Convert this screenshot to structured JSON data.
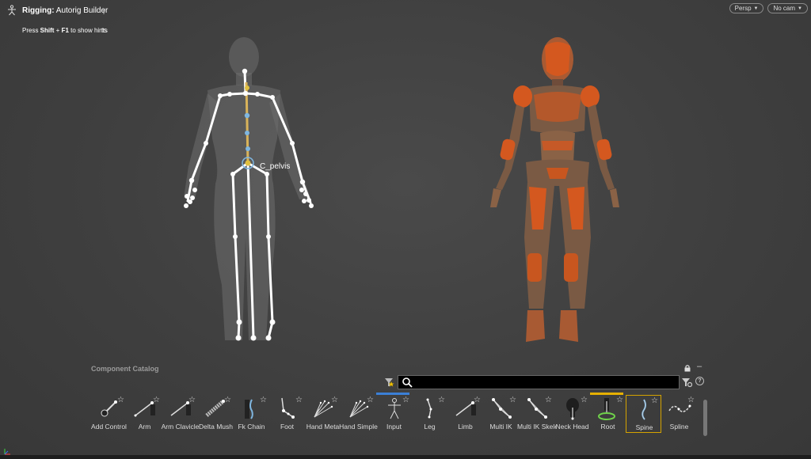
{
  "hud": {
    "title_bold": "Rigging:",
    "title_rest": " Autorig Builder",
    "hint_prefix": "Press ",
    "hint_key1": "Shift",
    "hint_plus": " + ",
    "hint_key2": "F1",
    "hint_suffix": " to show hints",
    "ghost_text_1": "r",
    "ghost_text_2": "ts"
  },
  "camera": {
    "view_mode": "Persp",
    "camera": "No cam"
  },
  "viewport": {
    "selected_joint_label": "C_pelvis"
  },
  "catalog": {
    "title": "Component Catalog",
    "search_placeholder": "",
    "help_label": "?",
    "minimize_label": "–",
    "items": [
      {
        "label": "Add Control",
        "icon": "add-control-icon"
      },
      {
        "label": "Arm",
        "icon": "arm-icon"
      },
      {
        "label": "Arm Clavicle",
        "icon": "arm-clavicle-icon"
      },
      {
        "label": "Delta Mush",
        "icon": "delta-mush-icon"
      },
      {
        "label": "Fk Chain",
        "icon": "fk-chain-icon"
      },
      {
        "label": "Foot",
        "icon": "foot-icon"
      },
      {
        "label": "Hand Meta",
        "icon": "hand-meta-icon"
      },
      {
        "label": "Hand Simple",
        "icon": "hand-simple-icon"
      },
      {
        "label": "Input",
        "icon": "input-icon"
      },
      {
        "label": "Leg",
        "icon": "leg-icon"
      },
      {
        "label": "Limb",
        "icon": "limb-icon"
      },
      {
        "label": "Multi IK",
        "icon": "multi-ik-icon"
      },
      {
        "label": "Multi IK Skeleton",
        "icon": "multi-ik-skeleton-icon"
      },
      {
        "label": "Neck Head",
        "icon": "neck-head-icon"
      },
      {
        "label": "Root",
        "icon": "root-icon"
      },
      {
        "label": "Spine",
        "icon": "spine-icon"
      },
      {
        "label": "Spline",
        "icon": "spline-icon"
      }
    ]
  },
  "colors": {
    "accent_selected": "#d5a300",
    "input_bar": "#3b7fd6",
    "root_bar": "#e6b000",
    "mannequin_orange": "#d4581f",
    "mannequin_brown": "#7a5a44"
  }
}
